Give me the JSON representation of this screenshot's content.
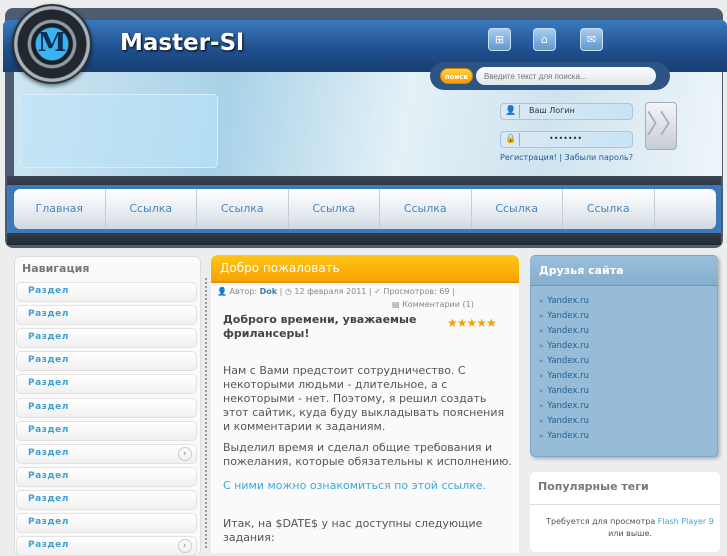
{
  "header": {
    "site_name": "Master-Sl",
    "logo_letter": "M",
    "icons": [
      "sitemap-icon",
      "home-icon",
      "mail-icon"
    ]
  },
  "search": {
    "button": "поиск",
    "placeholder": "Введите текст для поиска..."
  },
  "login": {
    "login_placeholder": "Ваш Логин",
    "password_value": "•••••••",
    "go": "〉〉",
    "register": "Регистрация!",
    "separator": "|",
    "forgot": "Забыли пароль?"
  },
  "nav": [
    "Главная",
    "Ссылка",
    "Ссылка",
    "Ссылка",
    "Ссылка",
    "Ссылка",
    "Ссылка"
  ],
  "sidebar": {
    "title": "Навигация",
    "items": [
      "Раздел",
      "Раздел",
      "Раздел",
      "Раздел",
      "Раздел",
      "Раздел",
      "Раздел",
      "Раздел",
      "Раздел",
      "Раздел",
      "Раздел",
      "Раздел"
    ]
  },
  "post": {
    "title": "Добро пожаловать",
    "author_label": "Автор:",
    "author": "Dok",
    "date": "12 февраля 2011",
    "views": "Просмотров: 69",
    "comments": "Комментарии (1)",
    "heading": "Доброго времени, уважаемые фрилансеры!",
    "rating": 5,
    "p1": "Нам с Вами предстоит сотрудничество. С некоторыми людьми - длительное, а с некоторыми - нет. Поэтому, я решил создать этот сайтик, куда буду выкладывать пояснения и комментарии к заданиям.",
    "p2": "Выделил время и сделал общие требования и пожелания, которые обязательны к исполнению.",
    "link": "С ними можно ознакомиться по этой ссылке.",
    "p3": "Итак, на $DATE$ у нас доступны следующие задания:"
  },
  "friends": {
    "title": "Друзья сайта",
    "items": [
      "Yandex.ru",
      "Yandex.ru",
      "Yandex.ru",
      "Yandex.ru",
      "Yandex.ru",
      "Yandex.ru",
      "Yandex.ru",
      "Yandex.ru",
      "Yandex.ru",
      "Yandex.ru"
    ]
  },
  "tags": {
    "title": "Популярные теги",
    "text_before": "Требуется для просмотра",
    "link": "Flash Player 9",
    "text_after": "или выше."
  },
  "colors": {
    "accent_orange": "#f7a200",
    "link_blue": "#3fa6d8",
    "header_blue": "#1e4f8c"
  }
}
